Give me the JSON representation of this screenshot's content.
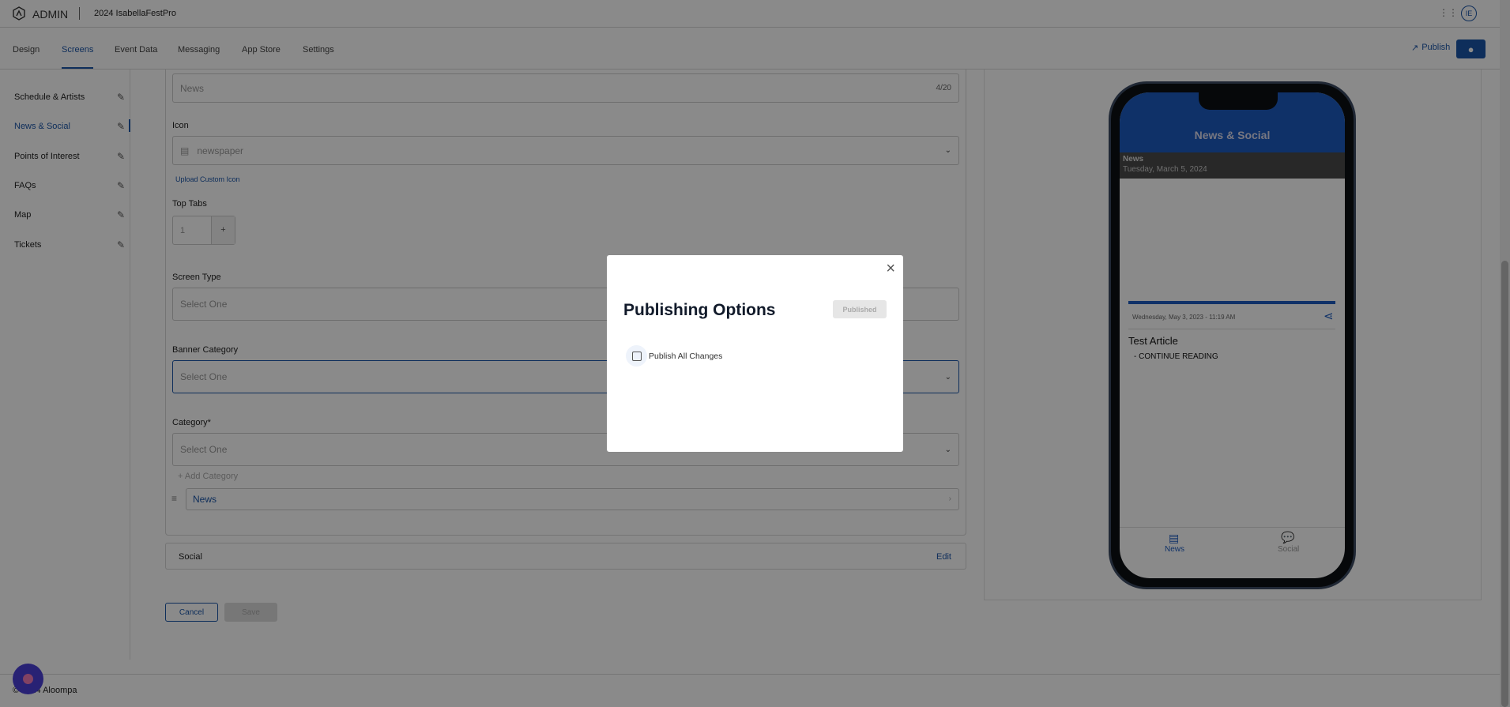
{
  "header": {
    "brand": "ADMIN",
    "project": "2024 IsabellaFestPro",
    "avatar": "IE"
  },
  "nav": {
    "tabs": [
      {
        "label": "Design"
      },
      {
        "label": "Screens"
      },
      {
        "label": "Event Data"
      },
      {
        "label": "Messaging"
      },
      {
        "label": "App Store"
      },
      {
        "label": "Settings"
      }
    ],
    "publish": "Publish"
  },
  "sidebar": {
    "items": [
      {
        "label": "Schedule & Artists"
      },
      {
        "label": "News & Social"
      },
      {
        "label": "Points of Interest"
      },
      {
        "label": "FAQs"
      },
      {
        "label": "Map"
      },
      {
        "label": "Tickets"
      }
    ]
  },
  "form": {
    "name_placeholder": "News",
    "name_counter": "4/20",
    "icon_label": "Icon",
    "icon_value": "newspaper",
    "upload_icon": "Upload Custom Icon",
    "top_tabs_label": "Top Tabs",
    "top_tabs_value": "1",
    "plus": "+",
    "screen_type_label": "Screen Type",
    "screen_type_value": "Select One",
    "banner_label": "Banner Category",
    "banner_value": "Select One",
    "category_label": "Category*",
    "category_value": "Select One",
    "add_category": "+ Add Category",
    "category_item": "News",
    "social_label": "Social",
    "social_edit": "Edit",
    "cancel": "Cancel",
    "save": "Save"
  },
  "preview": {
    "title": "News & Social",
    "band_title": "News",
    "band_date": "Tuesday, March 5, 2024",
    "article_date": "Wednesday, May 3, 2023 - 11:19 AM",
    "article_title": "Test Article",
    "continue": "- CONTINUE READING",
    "tabs": [
      {
        "label": "News"
      },
      {
        "label": "Social"
      }
    ]
  },
  "modal": {
    "title": "Publishing Options",
    "status_button": "Published",
    "checkbox_label": "Publish All Changes"
  },
  "footer": {
    "copyright": "© 2024 Aloompa"
  },
  "colors": {
    "accent": "#1a55a8",
    "chat": "#4a3fd6"
  }
}
